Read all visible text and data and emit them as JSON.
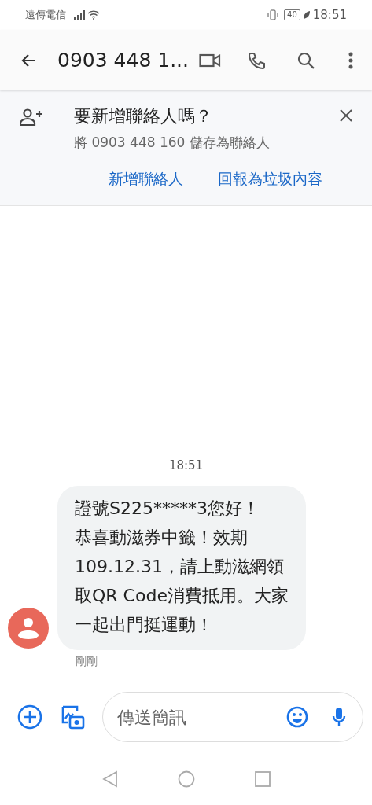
{
  "status_bar": {
    "carrier": "遠傳電信",
    "battery": "40",
    "time": "18:51"
  },
  "app_bar": {
    "title": "0903 448 1..."
  },
  "add_contact_banner": {
    "title": "要新增聯絡人嗎？",
    "subtitle": "將 0903 448 160 儲存為聯絡人",
    "actions": [
      "新增聯絡人",
      "回報為垃圾內容"
    ]
  },
  "conversation": {
    "timestamp": "18:51",
    "messages": [
      {
        "lines": [
          "證號S225*****3您好！",
          "恭喜動滋券中籤！效期",
          "109.12.31，請上動滋網領",
          "取QR Code消費抵用。大家",
          "一起出門挺運動！"
        ],
        "time": "剛剛"
      }
    ]
  },
  "composer": {
    "placeholder": "傳送簡訊"
  }
}
